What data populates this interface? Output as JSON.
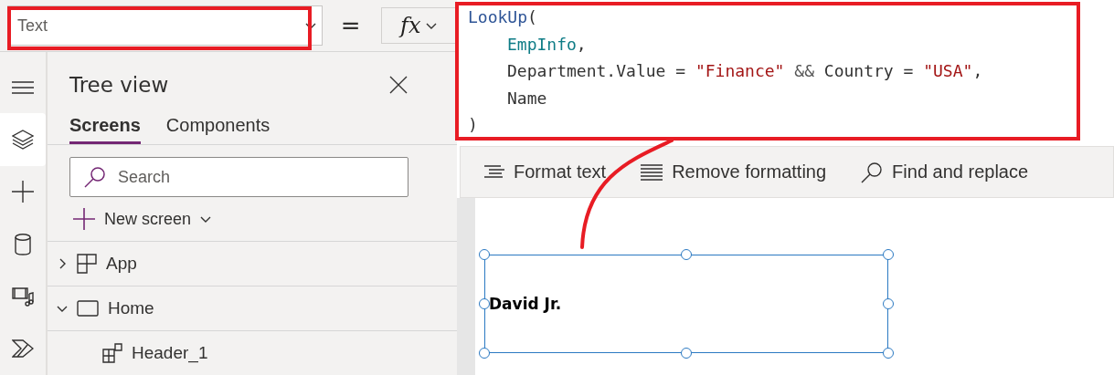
{
  "property_bar": {
    "property": "Text",
    "equals": "=",
    "fx": "fx"
  },
  "rail": [
    {
      "kind": "menu",
      "selected": false
    },
    {
      "kind": "layers",
      "selected": true
    },
    {
      "kind": "plus",
      "selected": false
    },
    {
      "kind": "database",
      "selected": false
    },
    {
      "kind": "media",
      "selected": false
    },
    {
      "kind": "automate",
      "selected": false
    }
  ],
  "tree_view": {
    "title": "Tree view",
    "tabs": [
      {
        "label": "Screens",
        "selected": true
      },
      {
        "label": "Components",
        "selected": false
      }
    ],
    "search": {
      "placeholder": "Search"
    },
    "new_screen": "New screen",
    "items": [
      {
        "label": "App",
        "kind": "app",
        "expanded": false
      },
      {
        "label": "Home",
        "kind": "screen",
        "expanded": true,
        "children": [
          {
            "label": "Header_1",
            "kind": "component"
          }
        ]
      }
    ]
  },
  "formula": {
    "lines": [
      {
        "indent": false,
        "tokens": [
          {
            "kind": "function",
            "text": "LookUp"
          },
          {
            "kind": "plain",
            "text": "("
          }
        ]
      },
      {
        "indent": true,
        "tokens": [
          {
            "kind": "source",
            "text": "EmpInfo"
          },
          {
            "kind": "plain",
            "text": ","
          }
        ]
      },
      {
        "indent": true,
        "tokens": [
          {
            "kind": "plain",
            "text": "Department.Value = "
          },
          {
            "kind": "string",
            "text": "\"Finance\""
          },
          {
            "kind": "operator",
            "text": " && "
          },
          {
            "kind": "plain",
            "text": "Country = "
          },
          {
            "kind": "string",
            "text": "\"USA\""
          },
          {
            "kind": "plain",
            "text": ","
          }
        ]
      },
      {
        "indent": true,
        "tokens": [
          {
            "kind": "plain",
            "text": "Name"
          }
        ]
      },
      {
        "indent": false,
        "tokens": [
          {
            "kind": "plain",
            "text": ")"
          }
        ]
      }
    ]
  },
  "toolbar": [
    {
      "kind": "format",
      "label": "Format text"
    },
    {
      "kind": "remove",
      "label": "Remove formatting"
    },
    {
      "kind": "search",
      "label": "Find and replace"
    }
  ],
  "canvas": {
    "label_text": "David Jr.",
    "selected": true
  },
  "annotations": [
    {
      "kind": "frame"
    },
    {
      "kind": "frame"
    },
    {
      "kind": "connector"
    }
  ]
}
